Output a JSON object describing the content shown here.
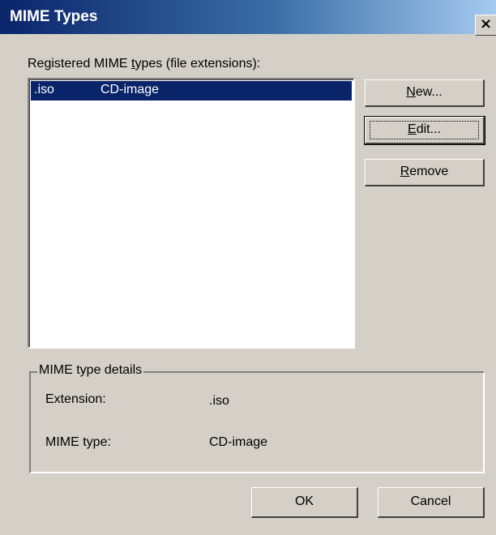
{
  "window": {
    "title": "MIME Types",
    "close_glyph": "×"
  },
  "list": {
    "label_prefix": "Registered MIME ",
    "label_mnemonic": "t",
    "label_suffix": "ypes (file extensions):",
    "items": [
      {
        "extension": ".iso",
        "type": "CD-image",
        "selected": true
      }
    ]
  },
  "buttons": {
    "new": {
      "mnemonic": "N",
      "rest": "ew..."
    },
    "edit": {
      "mnemonic": "E",
      "rest": "dit..."
    },
    "remove": {
      "mnemonic": "R",
      "rest": "emove"
    },
    "ok": "OK",
    "cancel": "Cancel"
  },
  "details": {
    "group_title": "MIME type details",
    "extension_label": "Extension:",
    "extension_value": ".iso",
    "type_label": "MIME type:",
    "type_value": "CD-image"
  },
  "colors": {
    "dialog_bg": "#d4d0c8",
    "selection_bg": "#0a246a",
    "title_gradient_start": "#0a246a",
    "title_gradient_end": "#a6caf0"
  },
  "icons": {
    "close": "close-icon"
  }
}
